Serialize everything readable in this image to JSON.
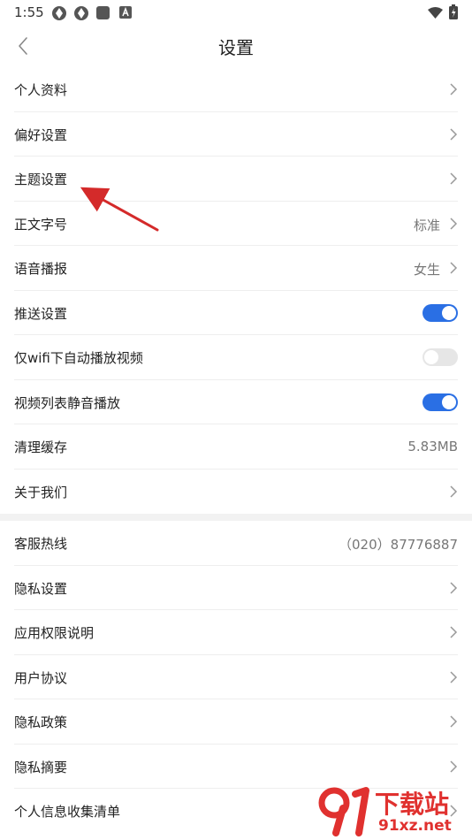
{
  "status_bar": {
    "time": "1:55",
    "icons": [
      "notification-icon",
      "notification-icon",
      "square-icon",
      "a-badge-icon",
      "wifi-icon",
      "battery-icon"
    ]
  },
  "header": {
    "back_icon": "chevron-left-icon",
    "title": "设置"
  },
  "section1": [
    {
      "label": "个人资料",
      "type": "chevron"
    },
    {
      "label": "偏好设置",
      "type": "chevron"
    },
    {
      "label": "主题设置",
      "type": "chevron"
    },
    {
      "label": "正文字号",
      "type": "value-chevron",
      "value": "标准"
    },
    {
      "label": "语音播报",
      "type": "value-chevron",
      "value": "女生"
    },
    {
      "label": "推送设置",
      "type": "toggle",
      "on": true
    },
    {
      "label": "仅wifi下自动播放视频",
      "type": "toggle",
      "on": false
    },
    {
      "label": "视频列表静音播放",
      "type": "toggle",
      "on": true
    },
    {
      "label": "清理缓存",
      "type": "value",
      "value": "5.83MB"
    },
    {
      "label": "关于我们",
      "type": "chevron"
    }
  ],
  "section2": [
    {
      "label": "客服热线",
      "type": "value",
      "value": "（020）87776887"
    },
    {
      "label": "隐私设置",
      "type": "chevron"
    },
    {
      "label": "应用权限说明",
      "type": "chevron"
    },
    {
      "label": "用户协议",
      "type": "chevron"
    },
    {
      "label": "隐私政策",
      "type": "chevron"
    },
    {
      "label": "隐私摘要",
      "type": "chevron"
    },
    {
      "label": "个人信息收集清单",
      "type": "chevron"
    }
  ],
  "watermark": {
    "logo_text": "下载站",
    "url_text": "91xz.net"
  },
  "colors": {
    "toggle_on": "#2a6fe4",
    "toggle_off": "#e6e6e6",
    "arrow": "#d42a2a",
    "watermark_red": "#e0312f"
  }
}
